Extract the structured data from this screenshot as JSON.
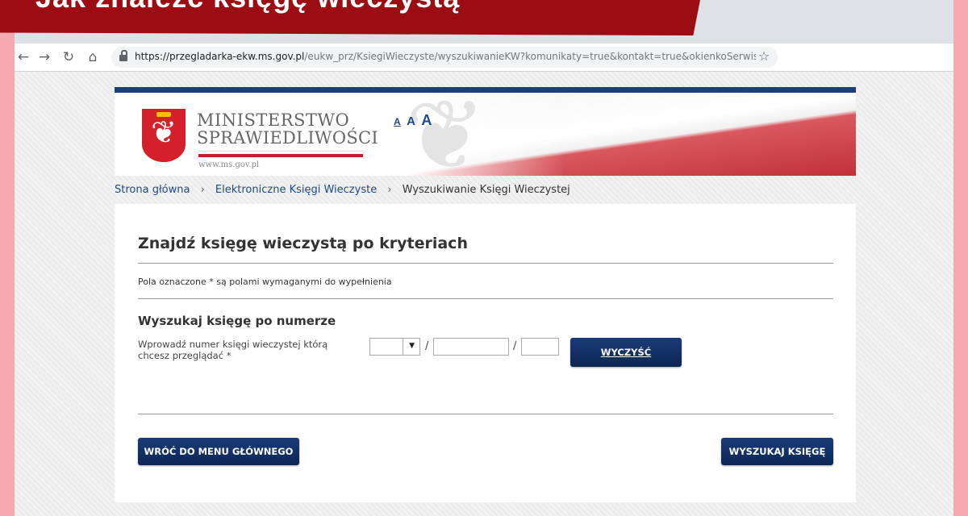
{
  "banner": {
    "title": "Jak znaleźć księgę wieczystą"
  },
  "browser": {
    "url_host": "https://przegladarka-ekw.ms.gov.pl",
    "url_path": "/eukw_prz/KsiegiWieczyste/wyszukiwanieKW?komunikaty=true&kontakt=true&okienkoSerwis...",
    "back_icon": "←",
    "forward_icon": "→",
    "reload_icon": "↻",
    "home_icon": "⌂",
    "star_icon": "☆"
  },
  "header": {
    "logo_line1": "MINISTERSTWO",
    "logo_line2": "SPRAWIEDLIWOŚCI",
    "logo_url": "www.ms.gov.pl",
    "font_sizes": [
      "A",
      "A",
      "A"
    ]
  },
  "breadcrumb": {
    "items": [
      "Strona główna",
      "Elektroniczne Księgi Wieczyste",
      "Wyszukiwanie Księgi Wieczystej"
    ],
    "separator": "›"
  },
  "form": {
    "title": "Znajdź księgę wieczystą po kryteriach",
    "required_note": "Pola oznaczone * są polami wymaganymi do wypełnienia",
    "section_title": "Wyszukaj księgę po numerze",
    "field_label": "Wprowadź numer księgi wieczystej którą chcesz przeglądać *",
    "court_code_value": "",
    "number_value": "",
    "check_digit_value": "",
    "slash": "/",
    "select_arrow": "▼",
    "clear_label": "WYCZYŚĆ",
    "back_label": "WRÓĆ DO MENU GŁÓWNEGO",
    "search_label": "WYSZUKAJ KSIĘGĘ"
  },
  "colors": {
    "banner": "#9b0d12",
    "navy": "#1c3f7a",
    "link": "#1c4a8c",
    "frame": "#f5a9b1"
  }
}
